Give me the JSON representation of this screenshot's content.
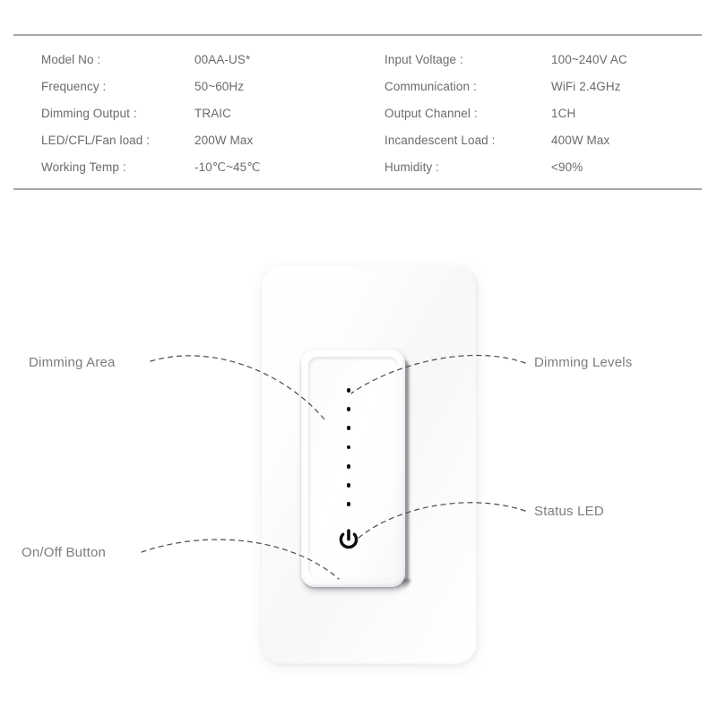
{
  "spec": {
    "rows": [
      {
        "label_left": "Model No :",
        "value_left": "00AA-US*",
        "label_right": "Input Voltage :",
        "value_right": "100~240V AC"
      },
      {
        "label_left": "Frequency :",
        "value_left": "50~60Hz",
        "label_right": "Communication :",
        "value_right": "WiFi 2.4GHz"
      },
      {
        "label_left": "Dimming Output :",
        "value_left": "TRAIC",
        "label_right": "Output Channel :",
        "value_right": "1CH"
      },
      {
        "label_left": "LED/CFL/Fan load :",
        "value_left": "200W Max",
        "label_right": "Incandescent Load :",
        "value_right": "400W Max"
      },
      {
        "label_left": "Working Temp :",
        "value_left": "-10℃~45℃",
        "label_right": "Humidity :",
        "value_right": "<90%"
      }
    ]
  },
  "diagram": {
    "annotations": {
      "dimming_area": "Dimming Area",
      "on_off_button": "On/Off Button",
      "dimming_levels": "Dimming Levels",
      "status_led": "Status LED"
    },
    "device": {
      "faceplate_name": "wall-plate",
      "rocker_name": "dimming-paddle",
      "power_icon": "power-icon",
      "led_count": 7
    },
    "colors": {
      "text_gray": "#7d7d80",
      "spec_text_gray": "#6b6b6b",
      "rule_gray": "#a8a8a8",
      "led_black": "#111114",
      "leader_line": "#4a4a4d"
    }
  }
}
